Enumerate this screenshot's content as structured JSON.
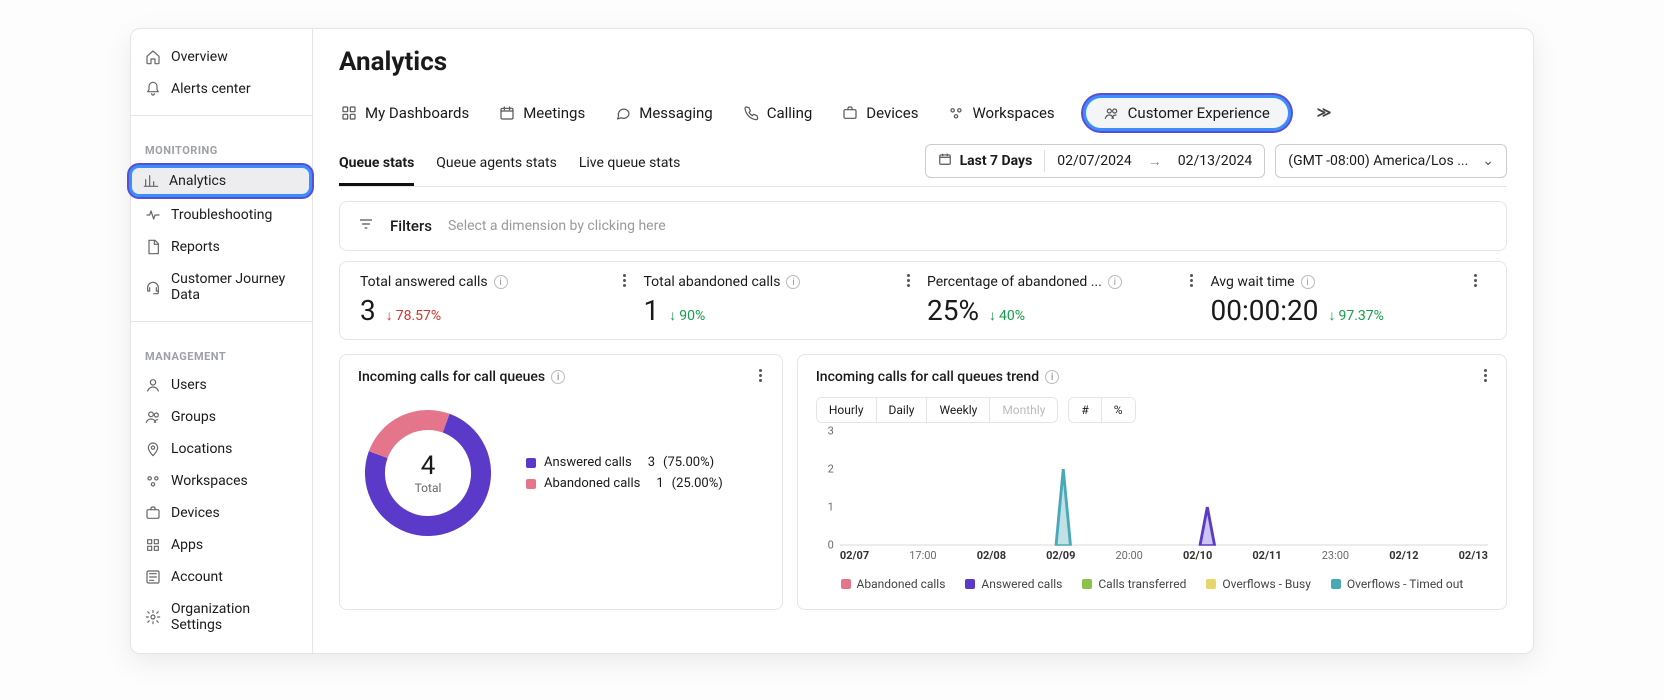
{
  "sidebar": {
    "top": [
      {
        "icon": "home-icon",
        "label": "Overview"
      },
      {
        "icon": "bell-icon",
        "label": "Alerts center"
      }
    ],
    "monitoring_header": "MONITORING",
    "monitoring": [
      {
        "icon": "bar-chart-icon",
        "label": "Analytics",
        "active": true
      },
      {
        "icon": "pulse-icon",
        "label": "Troubleshooting"
      },
      {
        "icon": "file-icon",
        "label": "Reports"
      },
      {
        "icon": "headset-icon",
        "label": "Customer Journey Data"
      }
    ],
    "management_header": "MANAGEMENT",
    "management": [
      {
        "icon": "user-icon",
        "label": "Users"
      },
      {
        "icon": "users-icon",
        "label": "Groups"
      },
      {
        "icon": "pin-icon",
        "label": "Locations"
      },
      {
        "icon": "workspaces-icon",
        "label": "Workspaces"
      },
      {
        "icon": "suitcase-icon",
        "label": "Devices"
      },
      {
        "icon": "grid-icon",
        "label": "Apps"
      },
      {
        "icon": "org-icon",
        "label": "Account"
      },
      {
        "icon": "gear-icon",
        "label": "Organization Settings"
      }
    ]
  },
  "page_title": "Analytics",
  "dash_tabs": [
    {
      "icon": "grid4-icon",
      "label": "My Dashboards"
    },
    {
      "icon": "calendar-icon",
      "label": "Meetings"
    },
    {
      "icon": "chat-icon",
      "label": "Messaging"
    },
    {
      "icon": "phone-icon",
      "label": "Calling"
    },
    {
      "icon": "suitcase-icon",
      "label": "Devices"
    },
    {
      "icon": "workspaces-icon",
      "label": "Workspaces"
    },
    {
      "icon": "people-icon",
      "label": "Customer Experience",
      "active": true
    }
  ],
  "sub_tabs": [
    {
      "label": "Queue stats",
      "active": true
    },
    {
      "label": "Queue agents stats"
    },
    {
      "label": "Live queue stats"
    }
  ],
  "date": {
    "range_label": "Last 7 Days",
    "start": "02/07/2024",
    "end": "02/13/2024",
    "tz": "(GMT -08:00) America/Los ..."
  },
  "filters": {
    "label": "Filters",
    "placeholder": "Select a dimension by clicking here"
  },
  "kpis": [
    {
      "title": "Total answered calls",
      "value": "3",
      "delta": "78.57%",
      "delta_color": "red"
    },
    {
      "title": "Total abandoned calls",
      "value": "1",
      "delta": "90%",
      "delta_color": "green"
    },
    {
      "title": "Percentage of abandoned ...",
      "value": "25%",
      "delta": "40%",
      "delta_color": "green"
    },
    {
      "title": "Avg wait time",
      "value": "00:00:20",
      "delta": "97.37%",
      "delta_color": "green"
    }
  ],
  "donut_card": {
    "title": "Incoming calls for call queues",
    "total_value": "4",
    "total_label": "Total",
    "series": [
      {
        "name": "Answered calls",
        "count": "3",
        "pct": "(75.00%)",
        "color": "#5b3ac9",
        "frac": 0.75
      },
      {
        "name": "Abandoned calls",
        "count": "1",
        "pct": "(25.00%)",
        "color": "#e4758a",
        "frac": 0.25
      }
    ]
  },
  "trend_card": {
    "title": "Incoming calls for call queues trend",
    "granularity": [
      "Hourly",
      "Daily",
      "Weekly",
      "Monthly"
    ],
    "granularity_disabled": "Monthly",
    "toggle": [
      "#",
      "%"
    ],
    "legend": [
      {
        "name": "Abandoned calls",
        "color": "#e4758a"
      },
      {
        "name": "Answered calls",
        "color": "#5b3ac9"
      },
      {
        "name": "Calls transferred",
        "color": "#8bc34a"
      },
      {
        "name": "Overflows - Busy",
        "color": "#e7d76a"
      },
      {
        "name": "Overflows - Timed out",
        "color": "#4aa9b8"
      }
    ]
  },
  "chart_data": {
    "type": "line",
    "title": "Incoming calls for call queues trend",
    "xlabel": "",
    "ylabel": "",
    "ylim": [
      0,
      3
    ],
    "y_ticks": [
      0,
      1,
      2,
      3
    ],
    "x_ticks": [
      "02/07",
      "17:00",
      "02/08",
      "02/09",
      "20:00",
      "02/10",
      "02/11",
      "23:00",
      "02/12",
      "02/13"
    ],
    "x_bold": [
      true,
      false,
      true,
      true,
      false,
      true,
      true,
      false,
      true,
      true
    ],
    "series": [
      {
        "name": "Overflows - Timed out",
        "color": "#4aa9b8",
        "fill": "rgba(74,169,184,0.35)",
        "points": [
          [
            3,
            0
          ],
          [
            3.1,
            2
          ],
          [
            3.2,
            0
          ]
        ]
      },
      {
        "name": "Answered calls",
        "color": "#5b3ac9",
        "fill": "rgba(91,58,201,0.30)",
        "points": [
          [
            5,
            0
          ],
          [
            5.1,
            1
          ],
          [
            5.2,
            0
          ]
        ]
      }
    ]
  }
}
